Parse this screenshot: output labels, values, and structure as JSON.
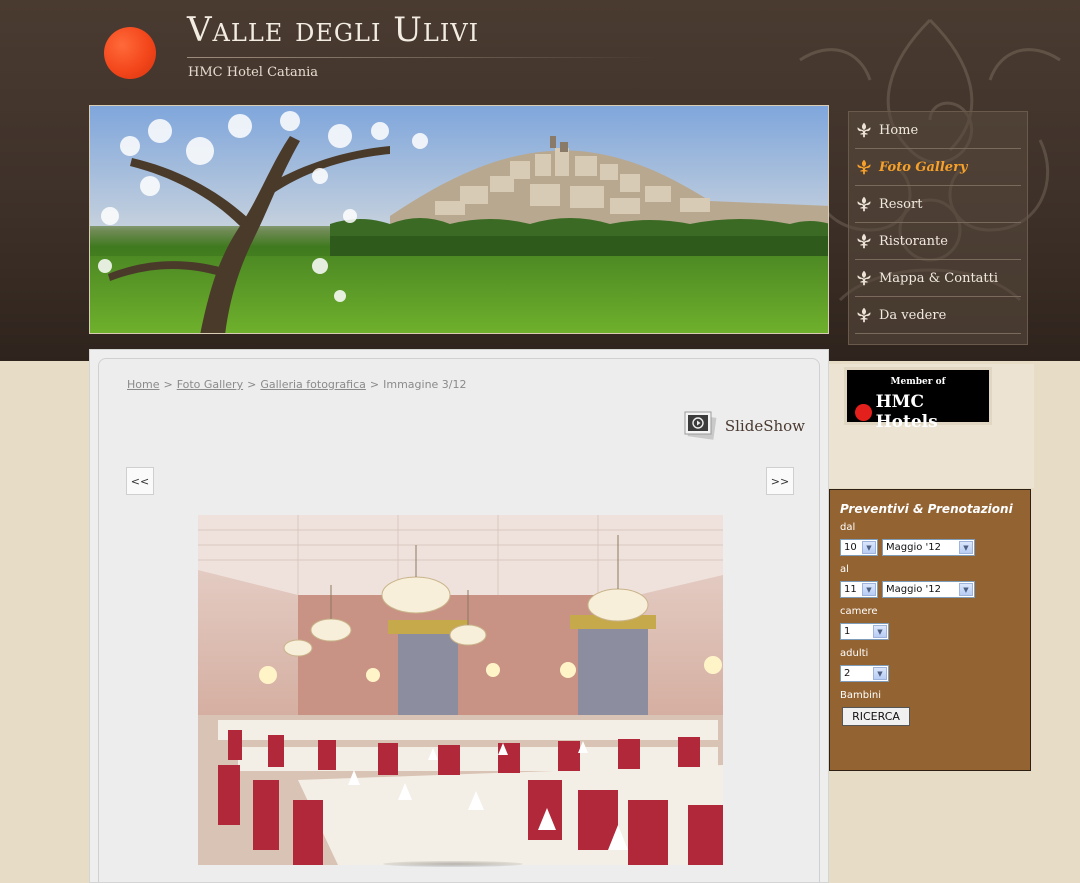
{
  "site": {
    "title": "Valle degli Ulivi",
    "subtitle": "HMC Hotel Catania"
  },
  "nav": {
    "items": [
      {
        "label": "Home",
        "active": false
      },
      {
        "label": "Foto Gallery",
        "active": true
      },
      {
        "label": "Resort",
        "active": false
      },
      {
        "label": "Ristorante",
        "active": false
      },
      {
        "label": "Mappa & Contatti",
        "active": false
      },
      {
        "label": "Da vedere",
        "active": false
      }
    ]
  },
  "breadcrumb": {
    "items": [
      "Home",
      "Foto Gallery",
      "Galleria fotografica"
    ],
    "current": "Immagine 3/12",
    "separator": ">"
  },
  "gallery": {
    "slideshow_label": "SlideShow",
    "prev_label": "<<",
    "next_label": ">>"
  },
  "badge": {
    "member_text": "Member of",
    "brand_text": "HMC Hotels"
  },
  "booking": {
    "title": "Preventivi & Prenotazioni",
    "labels": {
      "dal": "dal",
      "al": "al",
      "camere": "camere",
      "adulti": "adulti",
      "bambini": "Bambini"
    },
    "dal_day": "10",
    "dal_month": "Maggio '12",
    "al_day": "11",
    "al_month": "Maggio '12",
    "camere": "1",
    "adulti": "2",
    "submit_label": "RICERCA"
  },
  "colors": {
    "header_bg": "#3e3129",
    "accent_active": "#f7a12a",
    "logo_dot": "#f3461b",
    "booking_bg": "#946332"
  }
}
